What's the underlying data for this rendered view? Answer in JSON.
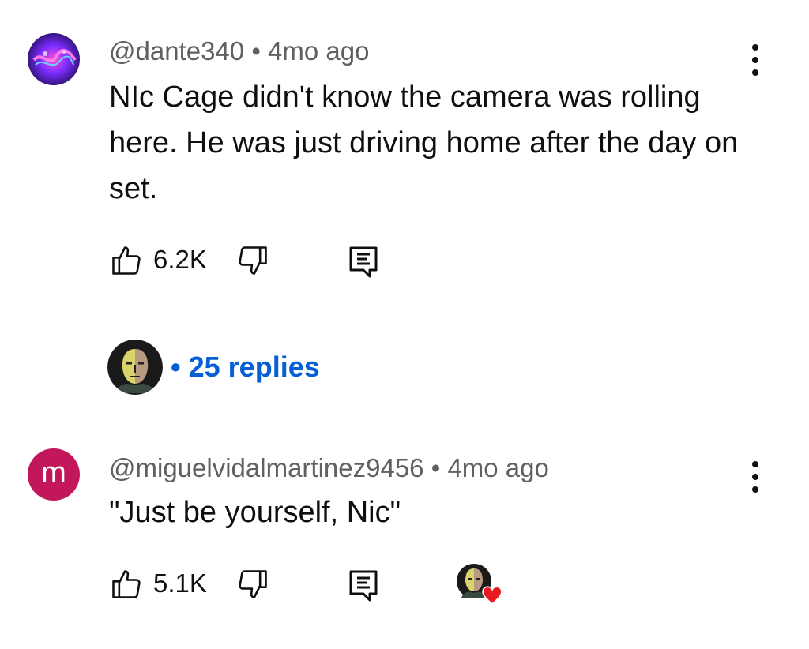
{
  "comments": [
    {
      "handle": "@dante340",
      "separator": "•",
      "time": "4mo ago",
      "text": "NIc Cage didn't know the camera was rolling here. He was just driving home after the day on set.",
      "likes": "6.2K",
      "avatar_icon": "neon-graphic-avatar"
    },
    {
      "handle": "@miguelvidalmartinez9456",
      "separator": "•",
      "time": "4mo ago",
      "text": "\"Just be yourself, Nic\"",
      "likes": "5.1K",
      "avatar_letter": "m",
      "avatar_color": "#c2185b"
    }
  ],
  "replies": {
    "dot": "•",
    "label": "25 replies",
    "color": "#065fd4"
  },
  "icons": {
    "like": "thumbs-up-icon",
    "dislike": "thumbs-down-icon",
    "reply": "reply-comment-icon",
    "more": "more-vert-icon",
    "creator_heart": "creator-heart-icon"
  },
  "colors": {
    "heart": "#e8191f",
    "meta_text": "#606060"
  }
}
